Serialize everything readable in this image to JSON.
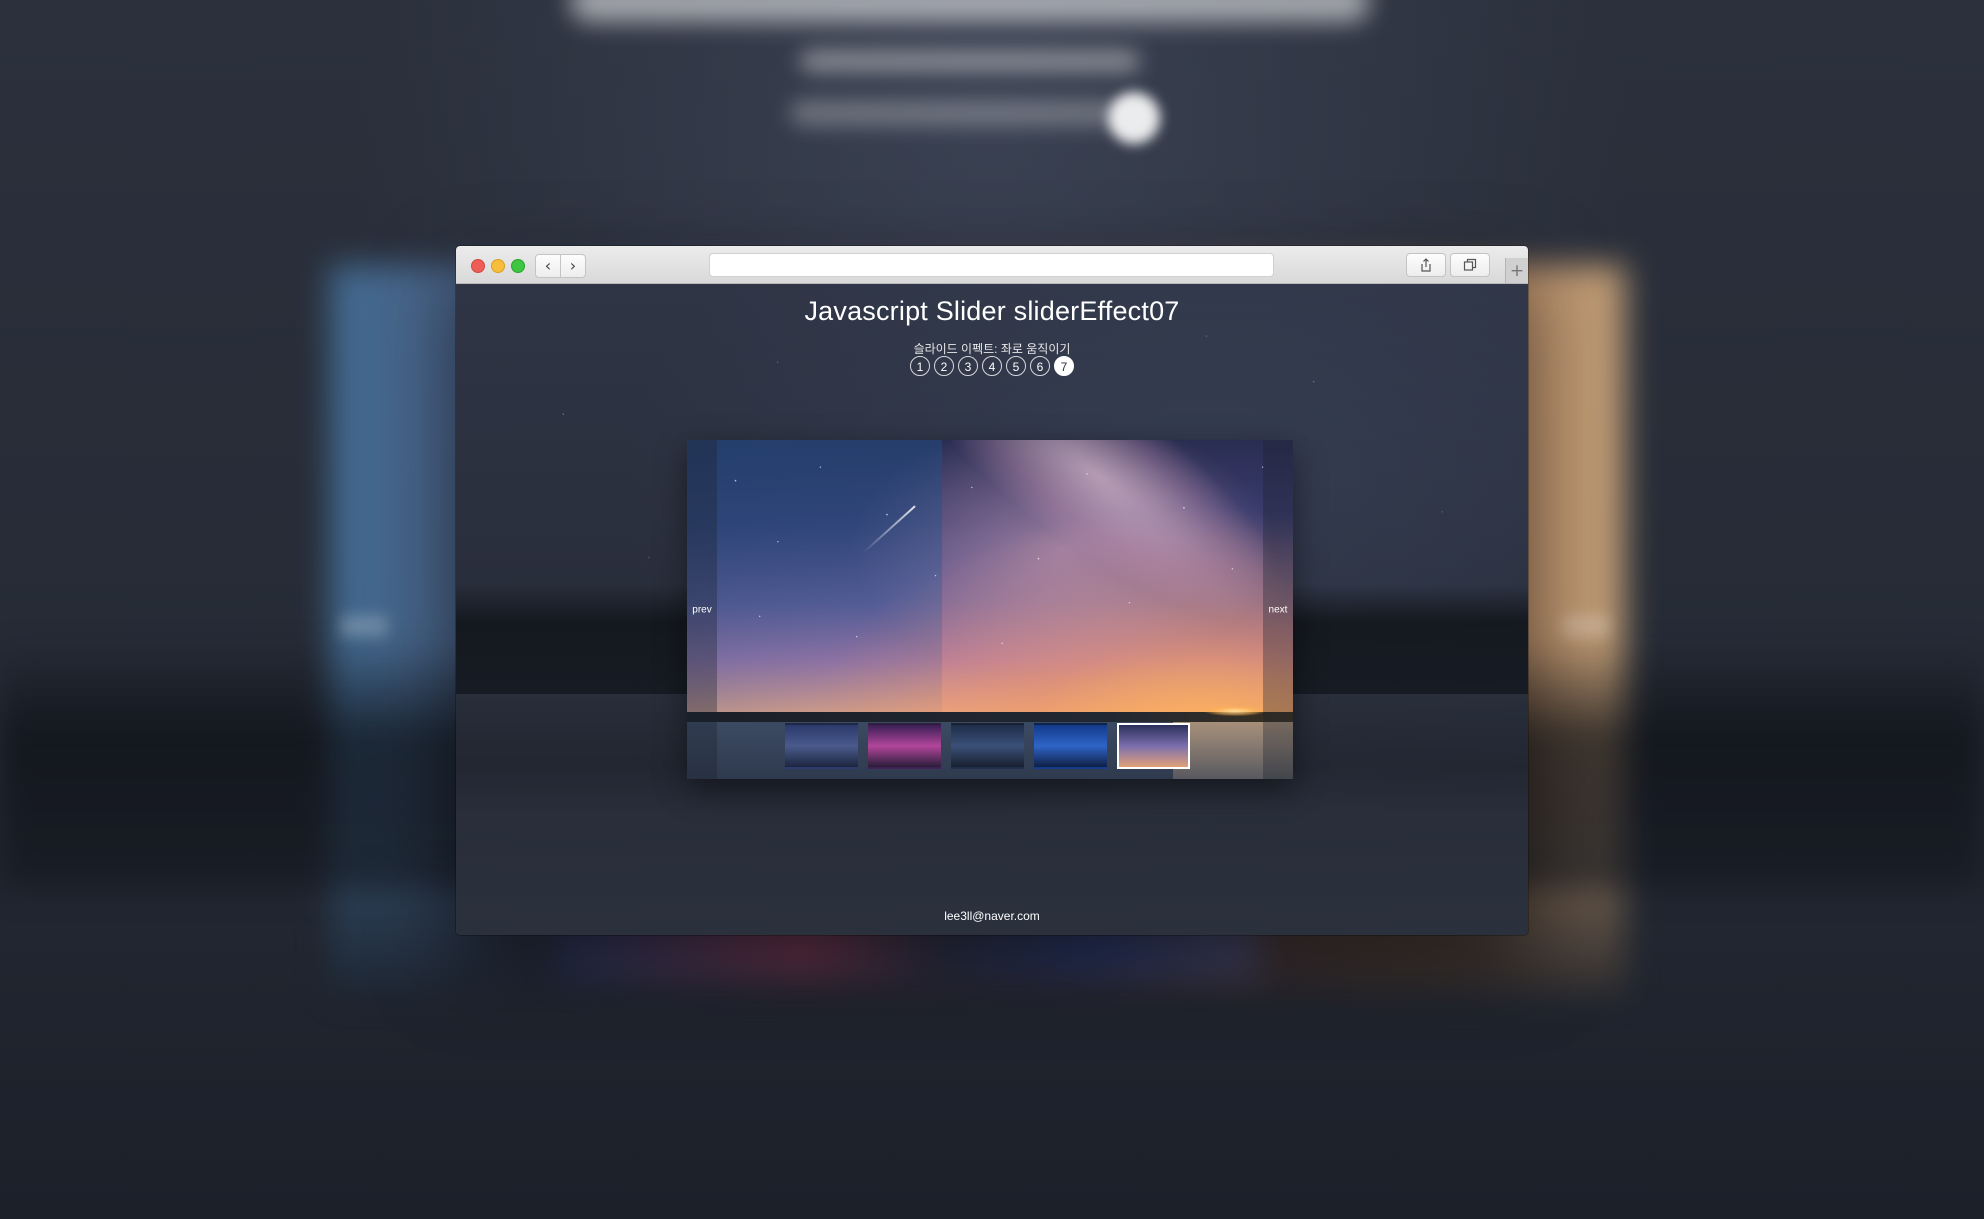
{
  "browser": {
    "url": ""
  },
  "page": {
    "title": "Javascript Slider sliderEffect07",
    "subtitle": "슬라이드 이펙트: 좌로 움직이기",
    "pager": [
      {
        "label": "1",
        "active": false
      },
      {
        "label": "2",
        "active": false
      },
      {
        "label": "3",
        "active": false
      },
      {
        "label": "4",
        "active": false
      },
      {
        "label": "5",
        "active": false
      },
      {
        "label": "6",
        "active": false
      },
      {
        "label": "7",
        "active": true
      }
    ],
    "footer_email": "lee3ll@naver.com"
  },
  "slider": {
    "prev_label": "prev",
    "next_label": "next",
    "thumbnails": [
      {
        "colors": [
          "#2b3a6b",
          "#4a5a8c",
          "#1c2640"
        ],
        "active": false
      },
      {
        "colors": [
          "#3a1f55",
          "#b1469a",
          "#2a1d3a"
        ],
        "active": false
      },
      {
        "colors": [
          "#1e2e4a",
          "#3a5078",
          "#18202e"
        ],
        "active": false
      },
      {
        "colors": [
          "#123a8a",
          "#2f64c8",
          "#0f1f44"
        ],
        "active": false
      },
      {
        "colors": [
          "#2a2f5a",
          "#7b6fae",
          "#e0a078"
        ],
        "active": true
      }
    ]
  },
  "icons": {
    "back": "chevron-left-icon",
    "forward": "chevron-right-icon",
    "share": "share-icon",
    "tabs": "tabs-overview-icon",
    "new_tab": "plus-icon"
  }
}
